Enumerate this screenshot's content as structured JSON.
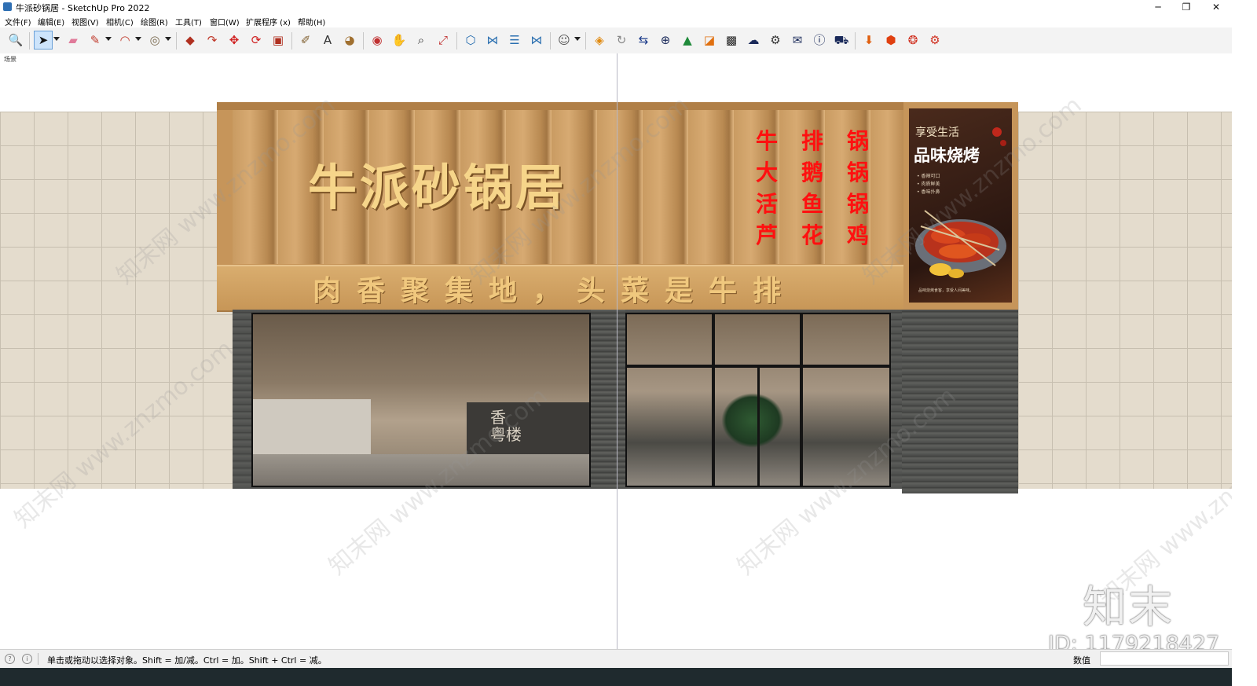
{
  "window": {
    "title": "牛派砂锅居 - SketchUp Pro 2022",
    "minimize": "─",
    "maximize": "❐",
    "close": "✕"
  },
  "menu": [
    {
      "label": "文件(F)"
    },
    {
      "label": "编辑(E)"
    },
    {
      "label": "视图(V)"
    },
    {
      "label": "相机(C)"
    },
    {
      "label": "绘图(R)"
    },
    {
      "label": "工具(T)"
    },
    {
      "label": "窗口(W)"
    },
    {
      "label": "扩展程序 (x)"
    },
    {
      "label": "帮助(H)"
    }
  ],
  "toolbar": [
    {
      "name": "zoom-extents-icon",
      "glyph": "🔍",
      "color": "#333333"
    },
    {
      "name": "select-tool-icon",
      "glyph": "➤",
      "color": "#111111",
      "active": true,
      "dropdown": true
    },
    {
      "name": "eraser-icon",
      "glyph": "▰",
      "color": "#e07a9a"
    },
    {
      "name": "pencil-icon",
      "glyph": "✎",
      "color": "#c0392b",
      "dropdown": true
    },
    {
      "name": "arc-icon",
      "glyph": "◠",
      "color": "#c0392b",
      "dropdown": true
    },
    {
      "name": "shape-icon",
      "glyph": "◎",
      "color": "#7a6a50",
      "dropdown": true
    },
    {
      "name": "push-pull-icon",
      "glyph": "◆",
      "color": "#b03020"
    },
    {
      "name": "follow-me-icon",
      "glyph": "↷",
      "color": "#c0392b"
    },
    {
      "name": "move-icon",
      "glyph": "✥",
      "color": "#d02020"
    },
    {
      "name": "rotate-icon",
      "glyph": "⟳",
      "color": "#d02020"
    },
    {
      "name": "scale-icon",
      "glyph": "▣",
      "color": "#b03020"
    },
    {
      "name": "tape-measure-icon",
      "glyph": "✐",
      "color": "#806030"
    },
    {
      "name": "text-tool-icon",
      "glyph": "A",
      "color": "#333333"
    },
    {
      "name": "paint-bucket-icon",
      "glyph": "◕",
      "color": "#a07030"
    },
    {
      "name": "orbit-icon",
      "glyph": "◉",
      "color": "#c03030"
    },
    {
      "name": "pan-icon",
      "glyph": "✋",
      "color": "#c09040"
    },
    {
      "name": "zoom-icon",
      "glyph": "⌕",
      "color": "#333333"
    },
    {
      "name": "zoom-window-icon",
      "glyph": "⤢",
      "color": "#c03030"
    },
    {
      "name": "3d-warehouse-icon",
      "glyph": "⬡",
      "color": "#2a6fb0"
    },
    {
      "name": "extension-warehouse-icon",
      "glyph": "⋈",
      "color": "#2a6fb0"
    },
    {
      "name": "layout-icon",
      "glyph": "☰",
      "color": "#2a6fb0"
    },
    {
      "name": "extension-manager-icon",
      "glyph": "⋈",
      "color": "#2a6fb0"
    },
    {
      "name": "account-icon",
      "glyph": "☺",
      "color": "#555555",
      "dropdown": true
    },
    {
      "name": "plugin-export-icon",
      "glyph": "◈",
      "color": "#e08a10"
    },
    {
      "name": "refresh-icon",
      "glyph": "↻",
      "color": "#888888"
    },
    {
      "name": "plugin-swap-icon",
      "glyph": "⇆",
      "color": "#1a3a8a"
    },
    {
      "name": "add-circle-icon",
      "glyph": "⊕",
      "color": "#1a2a5a"
    },
    {
      "name": "tree-icon",
      "glyph": "▲",
      "color": "#1f8a3a"
    },
    {
      "name": "stairs-icon",
      "glyph": "◪",
      "color": "#e07010"
    },
    {
      "name": "checker-icon",
      "glyph": "▩",
      "color": "#222222"
    },
    {
      "name": "cloud-icon",
      "glyph": "☁",
      "color": "#1a2a5a"
    },
    {
      "name": "settings-gear-icon",
      "glyph": "⚙",
      "color": "#333333"
    },
    {
      "name": "mail-icon",
      "glyph": "✉",
      "color": "#1a2a5a"
    },
    {
      "name": "info-icon",
      "glyph": "ⓘ",
      "color": "#1a2a5a"
    },
    {
      "name": "cart-icon",
      "glyph": "⛟",
      "color": "#1a2a5a"
    },
    {
      "name": "plugin-import-icon",
      "glyph": "⬇",
      "color": "#e06010"
    },
    {
      "name": "plugin-box-icon",
      "glyph": "⬢",
      "color": "#e04010"
    },
    {
      "name": "plugin-render-icon",
      "glyph": "❂",
      "color": "#d03020"
    },
    {
      "name": "plugin-settings-icon",
      "glyph": "⚙",
      "color": "#d03020"
    }
  ],
  "scene": {
    "label": "场景",
    "brand_name": "牛派砂锅居",
    "slogan": "肉香聚集地，头菜是牛排",
    "menu_lines": [
      "牛排锅",
      "大鹅锅",
      "活鱼锅",
      "芦花鸡"
    ],
    "poster": {
      "subtitle": "享受生活",
      "title": "品味烧烤",
      "bullets": [
        "• 香辣可口",
        "• 肉质鲜美",
        "• 香味扑鼻"
      ],
      "footer": "品味烧烤食客，享受人间美味。"
    },
    "counter_text": "香\n粤楼",
    "watermark_text": "知末网 www.znzmo.com"
  },
  "watermark": {
    "logo": "知末",
    "id": "ID: 1179218427"
  },
  "status": {
    "hint": "单击或拖动以选择对象。Shift = 加/减。Ctrl = 加。Shift + Ctrl = 减。",
    "measurements_label": "数值",
    "measurements_value": ""
  }
}
